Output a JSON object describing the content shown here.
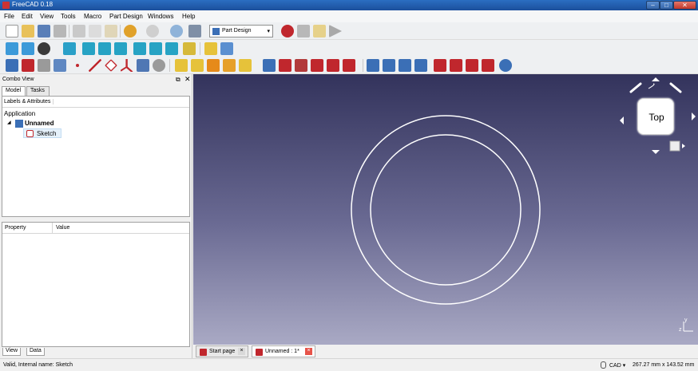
{
  "window": {
    "title": "FreeCAD 0.18",
    "min": "–",
    "max": "□",
    "close": "✕"
  },
  "menu": [
    "File",
    "Edit",
    "View",
    "Tools",
    "Macro",
    "Part Design",
    "Windows",
    "Help"
  ],
  "toolbar": {
    "workbench": "Part Design"
  },
  "combo": {
    "title": "Combo View",
    "float_icon": "⧉",
    "close_icon": "✕",
    "tabs": [
      "Model",
      "Tasks"
    ],
    "tree_header": "Labels & Attributes",
    "tree": {
      "root": "Application",
      "expander": "◢",
      "document": "Unnamed",
      "item": "Sketch"
    },
    "props": {
      "col1": "Property",
      "col2": "Value"
    },
    "prop_tabs": [
      "View",
      "Data"
    ]
  },
  "viewport": {
    "navcube_face": "Top",
    "background_top": "#33335c",
    "background_bottom": "#a9a9c4",
    "sketch_color": "#ffffff",
    "axis_y": "y",
    "axis_z": "z"
  },
  "doc_tabs": [
    {
      "label": "Start page",
      "close": "×"
    },
    {
      "label": "Unnamed : 1*",
      "close": "×"
    }
  ],
  "status": {
    "message": "Valid, Internal name: Sketch",
    "nav_style": "CAD ▾",
    "dimensions": "267.27 mm x 143.52 mm"
  },
  "icons": [
    "new-icon",
    "open-icon",
    "save-icon",
    "print-icon",
    "cut-icon",
    "copy-icon",
    "paste-icon",
    "undo-icon",
    "redo-icon",
    "refresh-icon",
    "whats-this-icon",
    "record-macro-icon",
    "stop-macro-icon",
    "edit-macro-icon",
    "run-macro-icon",
    "fit-all-icon",
    "fit-selection-icon",
    "draw-style-icon",
    "isometric-icon",
    "front-icon",
    "top-icon",
    "right-icon",
    "rear-icon",
    "bottom-icon",
    "left-icon",
    "measure-icon",
    "part-icon",
    "group-icon"
  ]
}
